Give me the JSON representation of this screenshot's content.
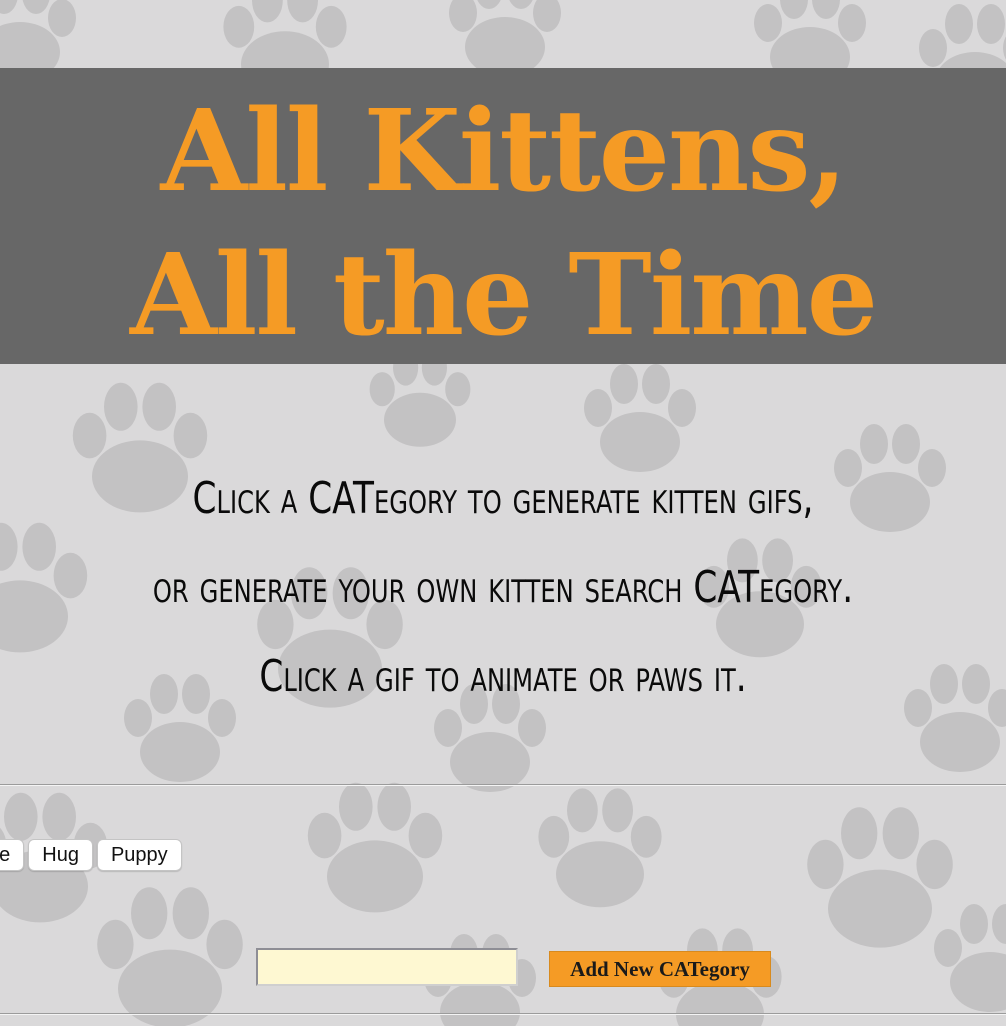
{
  "banner": {
    "title_line1": "All Kittens,",
    "title_line2": "All the Time"
  },
  "instructions": {
    "line1": "Click a CATegory to generate kitten gifs,",
    "line2": "or generate your own kitten search CATegory.",
    "line3": "Click a gif to animate or paws it."
  },
  "categories": [
    "ge",
    "Hug",
    "Puppy"
  ],
  "add_category": {
    "input_value": "",
    "button_label": "Add New CATegory"
  },
  "icons": {
    "background": "paw-print-icon"
  },
  "colors": {
    "page_background": "#dad9da",
    "banner_background": "#676767",
    "accent_orange": "#f59b25",
    "input_background": "#fef8d2",
    "paw_gray": "#bfbebf"
  }
}
